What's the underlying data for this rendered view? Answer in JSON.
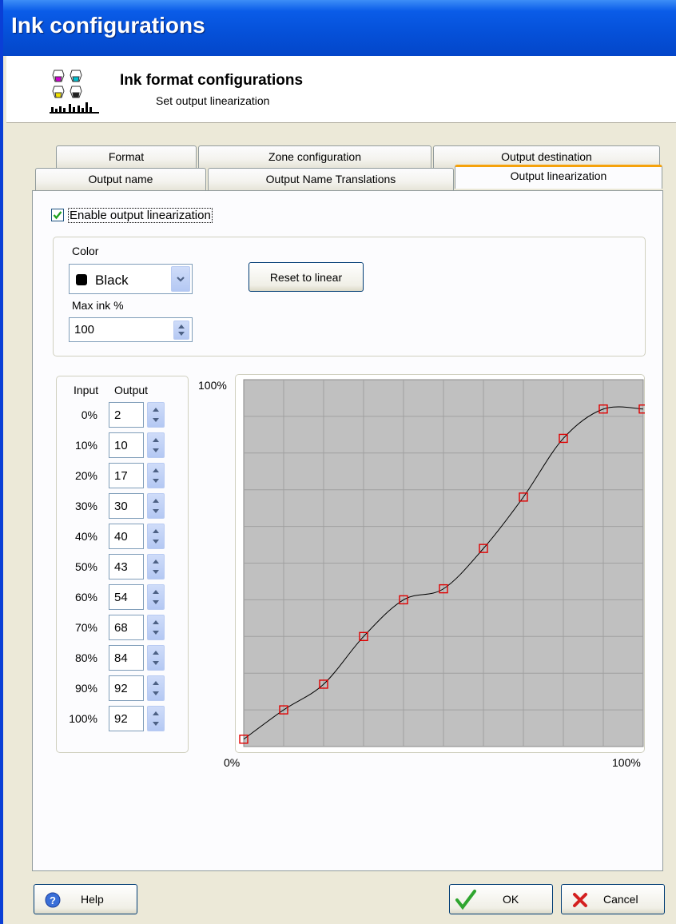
{
  "window": {
    "title": "Ink configurations"
  },
  "header": {
    "title": "Ink format configurations",
    "subtitle": "Set output linearization"
  },
  "tabs": {
    "row_back": [
      "Format",
      "Zone configuration",
      "Output destination"
    ],
    "row_front": [
      "Output name",
      "Output Name Translations",
      "Output linearization"
    ],
    "active": "Output linearization"
  },
  "enable": {
    "label": "Enable output linearization",
    "checked": true
  },
  "color": {
    "label": "Color",
    "selected": "Black",
    "swatch": "#000000"
  },
  "reset_button": "Reset to linear",
  "max_ink": {
    "label": "Max ink %",
    "value": "100"
  },
  "io_table": {
    "input_header": "Input",
    "output_header": "Output",
    "rows": [
      {
        "input": "0%",
        "output": "2"
      },
      {
        "input": "10%",
        "output": "10"
      },
      {
        "input": "20%",
        "output": "17"
      },
      {
        "input": "30%",
        "output": "30"
      },
      {
        "input": "40%",
        "output": "40"
      },
      {
        "input": "50%",
        "output": "43"
      },
      {
        "input": "60%",
        "output": "54"
      },
      {
        "input": "70%",
        "output": "68"
      },
      {
        "input": "80%",
        "output": "84"
      },
      {
        "input": "90%",
        "output": "92"
      },
      {
        "input": "100%",
        "output": "92"
      }
    ]
  },
  "chart_data": {
    "type": "line",
    "x": [
      0,
      10,
      20,
      30,
      40,
      50,
      60,
      70,
      80,
      90,
      100
    ],
    "values": [
      2,
      10,
      17,
      30,
      40,
      43,
      54,
      68,
      84,
      92,
      92
    ],
    "xlim": [
      0,
      100
    ],
    "ylim": [
      0,
      100
    ],
    "y_top_label": "100%",
    "x_start_label": "0%",
    "x_end_label": "100%",
    "grid": true,
    "plot_bg": "#c0c0c0",
    "line_color": "#000000",
    "marker_color": "#e00000"
  },
  "buttons": {
    "help": "Help",
    "ok": "OK",
    "cancel": "Cancel"
  },
  "colors": {
    "titlebar": "#0550d8",
    "active_tab_accent": "#f5a20b"
  }
}
